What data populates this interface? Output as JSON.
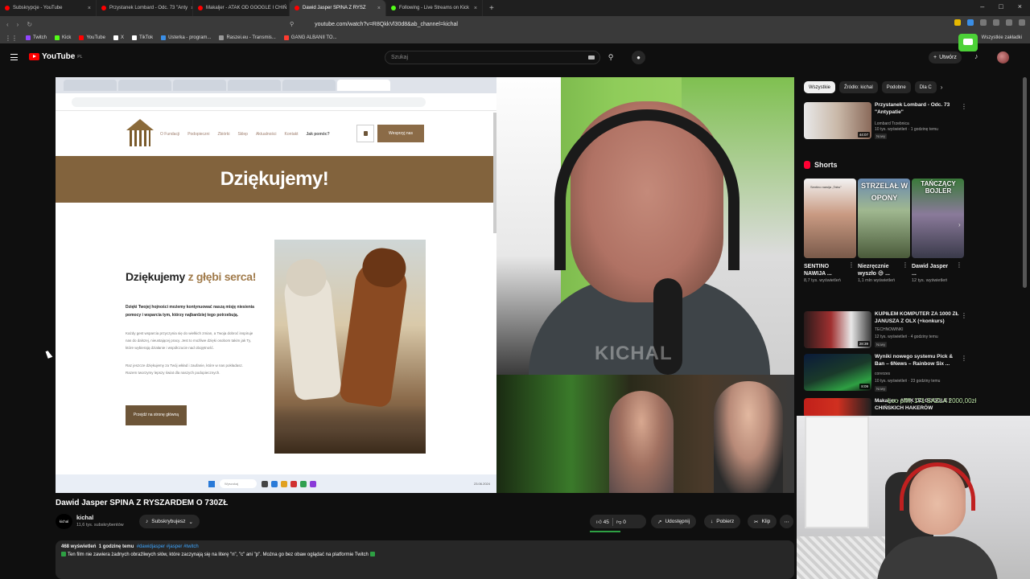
{
  "browser": {
    "tabs": [
      {
        "title": "Subskrypcje - YouTube",
        "color": "#ff0000"
      },
      {
        "title": "Przystanek Lombard - Odc. 73 \"Anty",
        "color": "#ff0000"
      },
      {
        "title": "Makaljer - ATAK OD GOOGLE I CHIŃ",
        "color": "#ff0000"
      },
      {
        "title": "Dawid Jasper SPINA Z RYSZ",
        "color": "#ff0000",
        "active": true
      },
      {
        "title": "Following - Live Streams on Kick",
        "color": "#53fc18"
      }
    ],
    "url": "youtube.com/watch?v=R8QkkVl30d8&ab_channel=kichal",
    "bookmarks": [
      {
        "label": "Twitch",
        "color": "#9146ff"
      },
      {
        "label": "Kick",
        "color": "#53fc18"
      },
      {
        "label": "YouTube",
        "color": "#ff0000"
      },
      {
        "label": "X",
        "color": "#ffffff"
      },
      {
        "label": "TikTok",
        "color": "#ffffff"
      },
      {
        "label": "Usterka - program...",
        "color": "#3a8ee6"
      },
      {
        "label": "Raszei.eu - Transmis...",
        "color": "#999999"
      },
      {
        "label": "GANG ALBANII TO...",
        "color": "#ff3b30"
      }
    ],
    "all_bookmarks": "Wszystkie zakładki"
  },
  "youtube": {
    "logo_text": "YouTube",
    "logo_country": "PL",
    "search_placeholder": "Szukaj",
    "create_label": "Utwórz"
  },
  "video_screen": {
    "site_menu": [
      "O Fundacji",
      "Podopieczni",
      "Zbiórki",
      "Sklep",
      "Aktualności",
      "Kontakt"
    ],
    "site_menu_strong": "Jak pomóc?",
    "support_button": "Wesprzyj nas",
    "banner_title": "Dziękujemy!",
    "thank_title_main": "Dziękujemy",
    "thank_title_accent": "z głębi serca!",
    "thank_lead": "Dzięki Twojej hojności możemy kontynuować naszą misję niesienia pomocy i wsparcia tym, którzy najbardziej tego potrzebują.",
    "thank_p1": "Każdy gest wsparcia przyczynia się do wielkich zmian, a Twoja dobroć inspiruje nas do dalszej, nieustającej pracy. Jest to możliwe dzięki osobom takim jak Ty, które wybierają działanie i współczucie nad obojętność.",
    "thank_p2": "Raz jeszcze dziękujemy za Twój wkład i zaufanie, które w nas pokładasz. Razem tworzymy lepszy świat dla naszych podopiecznych.",
    "home_button": "Przejdź na stronę główną",
    "taskbar_search": "Wyszukaj",
    "taskbar_date": "23.06.2024",
    "cam_watermark": "KICHAL"
  },
  "video": {
    "title": "Dawid Jasper SPINA Z RYSZARDEM O 730ZŁ",
    "channel_name": "kichal",
    "channel_avatar_text": "kichal",
    "subscribers": "11,6 tys. subskrybentów",
    "subscribed_label": "Subskrybujesz",
    "likes": "45",
    "dislikes": "0",
    "share_label": "Udostępnij",
    "download_label": "Pobierz",
    "clip_label": "Klip",
    "views": "468 wyświetleń",
    "uploaded": "1 godzinę temu",
    "tags": "#dawidjasper #jasper #twitch",
    "description": "Ten film nie zawiera żadnych obraźliwych słów, które zaczynają się na literę \"n\", \"c\" ani \"p\". Można go bez obaw oglądać na platformie Twitch"
  },
  "sidebar": {
    "chips": [
      "Wszystkie",
      "Źródło: kichal",
      "Podobne",
      "Dla C"
    ],
    "shorts_label": "Shorts",
    "recommended": [
      {
        "title": "Przystanek Lombard - Odc. 73 \"Antypatie\"",
        "channel": "Lombard Trzebnica",
        "meta": "10 tys. wyświetleń · 1 godzinę temu",
        "new": "Nowy",
        "duration": "44:07",
        "thumb": "#c9b8a8"
      },
      {
        "title": "KUPIŁEM KOMPUTER ZA 1000 ZŁ JANUSZA Z OLX (+konkurs)",
        "channel": "TECHNOWINKI",
        "meta": "12 tys. wyświetleń · 4 godziny temu",
        "new": "Nowy",
        "duration": "28:39",
        "thumb": "#a03030"
      },
      {
        "title": "Wyniki nowego systemu Pick & Ban – 6News – Rainbow Six ...",
        "channel": "corerzes",
        "meta": "10 tys. wyświetleń · 23 godziny temu",
        "new": "Nowy",
        "duration": "8:09",
        "thumb": "#1a3a2a"
      },
      {
        "title": "Makaljer - ATAK OD GOOGLE I CHIŃSKICH HAKERÓW",
        "channel": "",
        "meta": "",
        "new": "",
        "duration": "",
        "thumb": "#c0201a"
      }
    ],
    "shorts": [
      {
        "title": "SENTINO NAWIJA ...",
        "views": "8,7 tys. wyświetleń",
        "thumb_text": "Sentino nawija „Tabu\""
      },
      {
        "title": "Niezręcznie wyszło 😅 ...",
        "views": "1,1 mln wyświetleń",
        "thumb_text": "STRZELAŁ W OPONY"
      },
      {
        "title": "Dawid Jasper ...",
        "views": "12 tys. wyświetleń",
        "thumb_text": "TAŃCZĄCY BOJLER"
      }
    ]
  },
  "overlay": {
    "chat_line": "Łoo pffff, 171 SAZLA 2000,00zł"
  }
}
